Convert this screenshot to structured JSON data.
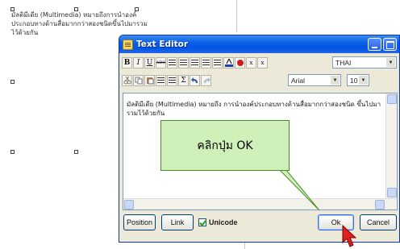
{
  "background": {
    "canvas_text": "มัลติมีเดีย (Multimedia) หมายถึงการนำองค์ประกอบทางด้านสื่อมากกว่าสองชนิดขึ้นไปมารวมไว้ด้วยกัน"
  },
  "window": {
    "title": "Text Editor",
    "title_icon": "app-icon",
    "controls": [
      "minimize-icon",
      "maximize-icon"
    ]
  },
  "toolbar1": {
    "bold": "B",
    "italic": "I",
    "underline": "U",
    "strike": "ABC",
    "color_icons": [
      "text-color-icon",
      "highlight-icon"
    ],
    "superscript": "x",
    "subscript": "x",
    "language": "THAI"
  },
  "toolbar2": {
    "font": "Arial",
    "size": "10",
    "icons": [
      "cut-icon",
      "copy-icon",
      "paste-icon",
      "outdent-icon",
      "indent-icon",
      "sigma-icon",
      "undo-icon",
      "redo-icon"
    ],
    "sigma": "Σ"
  },
  "editor": {
    "content": "มัลติมีเดีย (Multimedia) หมายถึง การนำองค์ประกอบทางด้านสื่อมากกว่าสองชนิด ขึ้นไปมารวมไว้ด้วยกัน"
  },
  "buttons": {
    "position": "Position",
    "link": "Link",
    "unicode_label": "Unicode",
    "unicode_checked": true,
    "ok": "Ok",
    "cancel": "Cancel"
  },
  "callout": {
    "text": "คลิกปุ่ม OK"
  },
  "colors": {
    "titlebar": "#0054e3",
    "window_bg": "#ece9d8",
    "callout_bg": "#cff0b8",
    "cursor": "#e02020"
  }
}
